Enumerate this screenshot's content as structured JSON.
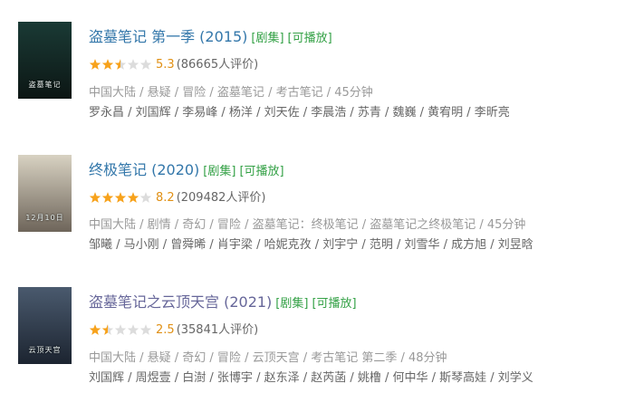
{
  "results": [
    {
      "title": "盗墓笔记 第一季 (2015)",
      "tag_series": "[剧集]",
      "tag_play": "[可播放]",
      "rating_value": 2.5,
      "score": "5.3",
      "votes": "(86665人评价)",
      "meta": "中国大陆 / 悬疑 / 冒险 / 盗墓笔记 / 考古笔记 / 45分钟",
      "cast": "罗永昌 / 刘国辉 / 李易峰 / 杨洋 / 刘天佐 / 李晨浩 / 苏青 / 魏巍 / 黄宥明 / 李昕亮",
      "poster_text": "盗墓笔记",
      "poster_colors": [
        "#1a3a35",
        "#0c1614"
      ]
    },
    {
      "title": "终极笔记 (2020)",
      "tag_series": "[剧集]",
      "tag_play": "[可播放]",
      "rating_value": 4,
      "score": "8.2",
      "votes": "(209482人评价)",
      "meta": "中国大陆 / 剧情 / 奇幻 / 冒险 / 盗墓笔记：终极笔记 / 盗墓笔记之终极笔记 / 45分钟",
      "cast": "邹曦 / 马小刚 / 曾舜晞 / 肖宇梁 / 哈妮克孜 / 刘宇宁 / 范明 / 刘雪华 / 成方旭 / 刘昱晗",
      "poster_text": "12月10日",
      "poster_colors": [
        "#d8d2c2",
        "#6e655a"
      ]
    },
    {
      "title": "盗墓笔记之云顶天宫 (2021)",
      "tag_series": "[剧集]",
      "tag_play": "[可播放]",
      "rating_value": 1.5,
      "score": "2.5",
      "votes": "(35841人评价)",
      "meta": "中国大陆 / 悬疑 / 奇幻 / 冒险 / 云顶天宫 / 考古笔记 第二季 / 48分钟",
      "cast": "刘国辉 / 周煜壹 / 白澍 / 张博宇 / 赵东泽 / 赵芮菡 / 姚橹 / 何中华 / 斯琴高娃 / 刘学义",
      "poster_text": "云顶天宫",
      "poster_colors": [
        "#4a5a6e",
        "#1c2430"
      ]
    }
  ],
  "colors": {
    "link": "#3377aa",
    "link_visited": "#666699",
    "tag": "#34a146",
    "star": "#f7a21b",
    "star_empty": "#dcdcdc",
    "score": "#e09015"
  }
}
